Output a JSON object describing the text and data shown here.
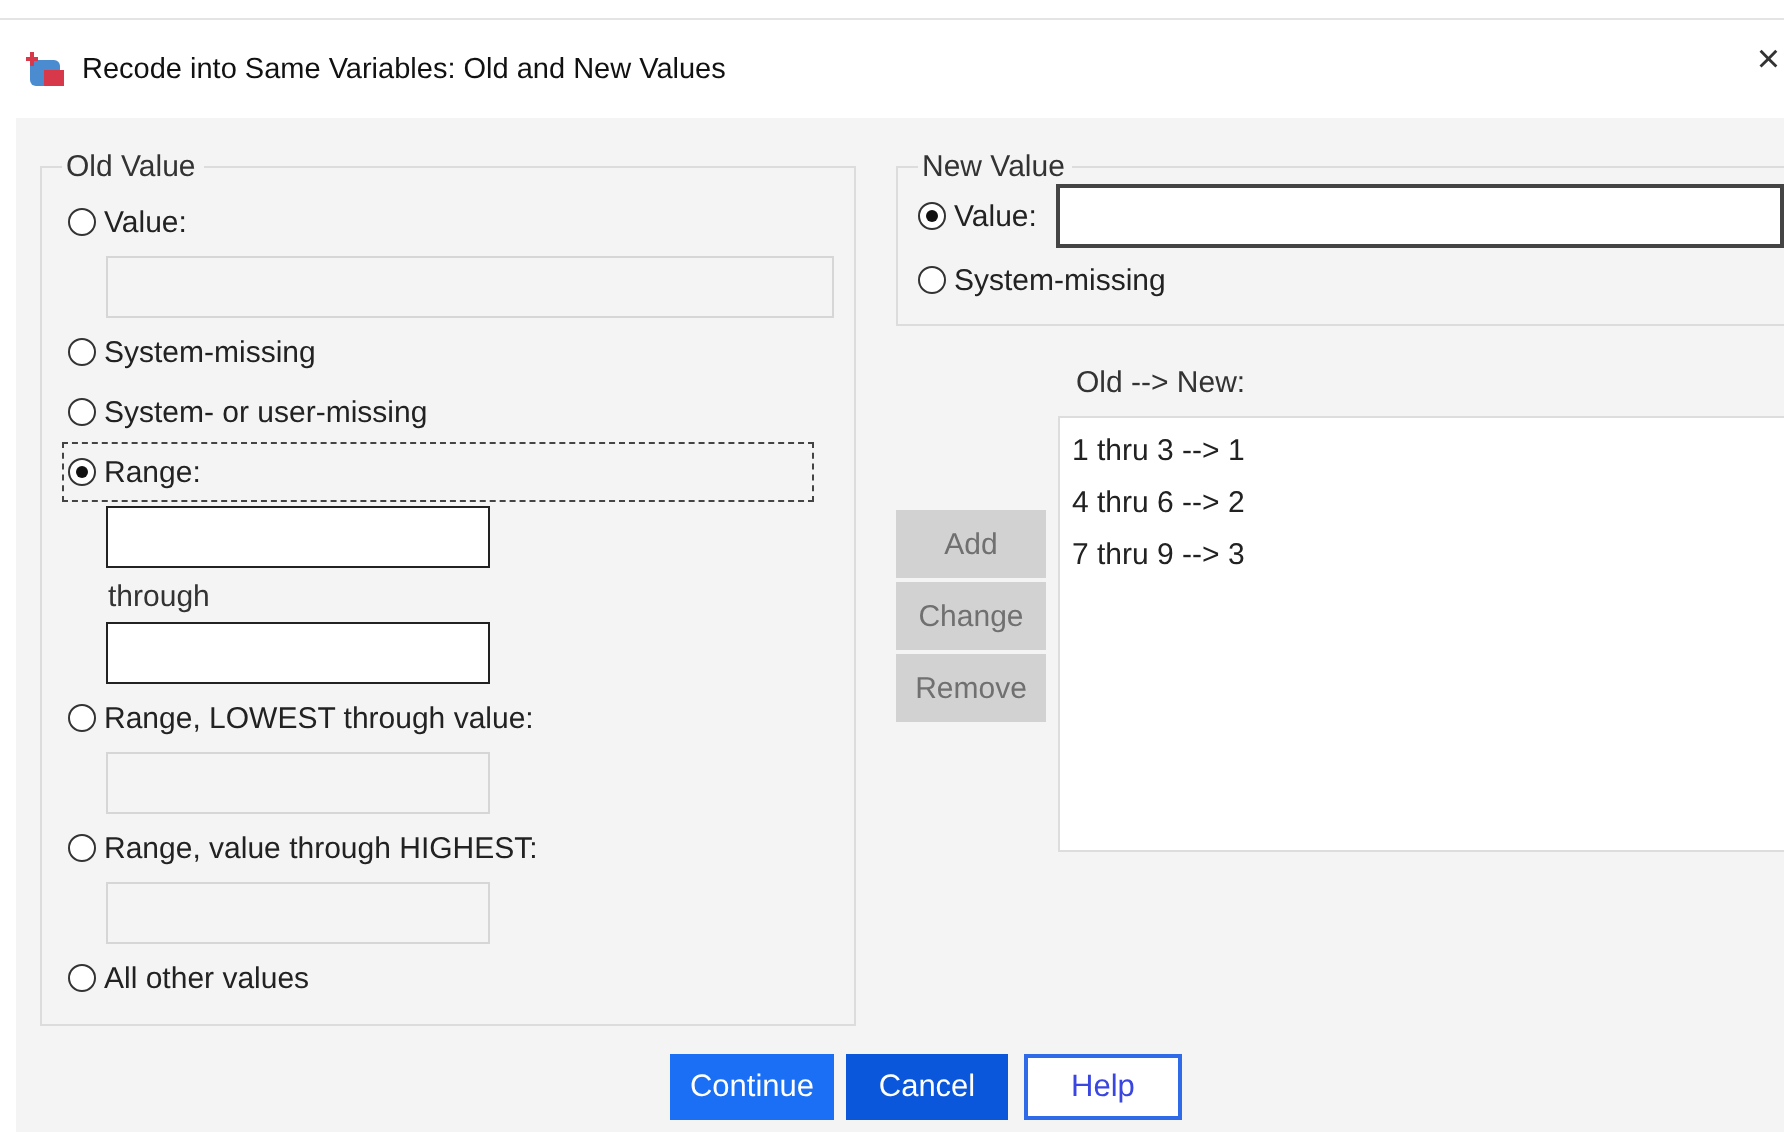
{
  "window": {
    "title": "Recode into Same Variables: Old and New Values",
    "close": "×"
  },
  "old_value": {
    "title": "Old Value",
    "options": [
      {
        "label": "Value:",
        "selected": false,
        "focused": false,
        "inputs": [
          {
            "enabled": false
          }
        ]
      },
      {
        "label": "System-missing",
        "selected": false,
        "focused": false
      },
      {
        "label": "System- or user-missing",
        "selected": false,
        "focused": false
      },
      {
        "label": "Range:",
        "selected": true,
        "focused": true,
        "inputs": [
          {
            "enabled": true
          },
          {
            "enabled": true,
            "caption": "through"
          }
        ]
      },
      {
        "label": "Range, LOWEST through value:",
        "selected": false,
        "focused": false,
        "inputs": [
          {
            "enabled": false
          }
        ]
      },
      {
        "label": "Range, value through HIGHEST:",
        "selected": false,
        "focused": false,
        "inputs": [
          {
            "enabled": false
          }
        ]
      },
      {
        "label": "All other values",
        "selected": false,
        "focused": false
      }
    ]
  },
  "new_value": {
    "title": "New Value",
    "options": [
      {
        "label": "Value:",
        "selected": true,
        "input": {
          "enabled": true
        }
      },
      {
        "label": "System-missing",
        "selected": false
      }
    ]
  },
  "mapping": {
    "label": "Old --> New:",
    "items": [
      "1 thru 3 --> 1",
      "4 thru 6 --> 2",
      "7 thru 9 --> 3"
    ]
  },
  "side_buttons": [
    {
      "label": "Add",
      "disabled": true
    },
    {
      "label": "Change",
      "disabled": true
    },
    {
      "label": "Remove",
      "disabled": true
    }
  ],
  "footer_buttons": [
    {
      "label": "Continue",
      "kind": "default"
    },
    {
      "label": "Cancel",
      "kind": "action"
    },
    {
      "label": "Help",
      "kind": "outline"
    }
  ]
}
